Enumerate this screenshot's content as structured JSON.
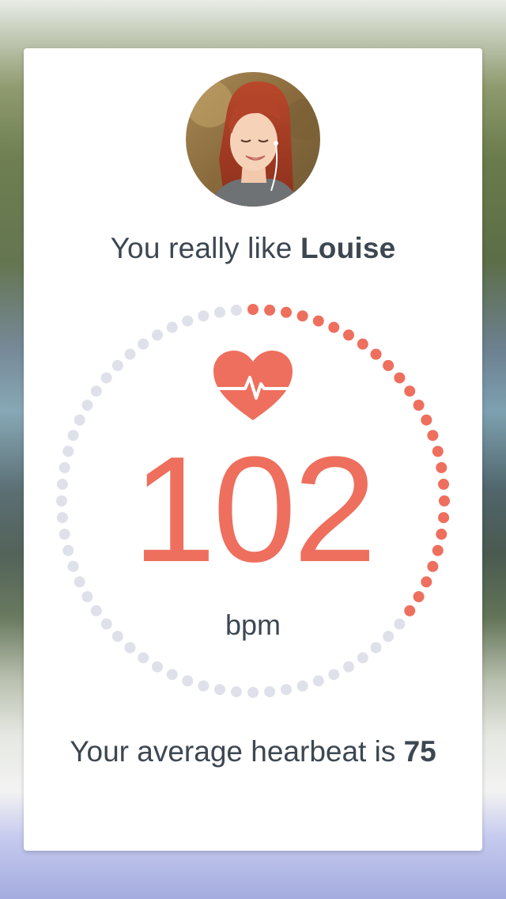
{
  "match": {
    "prefix": "You really like ",
    "name": "Louise"
  },
  "heartbeat": {
    "value": "102",
    "unit": "bpm",
    "progress_fraction": 0.36,
    "icon": "heart-pulse-icon"
  },
  "average": {
    "prefix": "Your average hearbeat is ",
    "value": "75"
  },
  "colors": {
    "accent": "#ee6f5d",
    "ring_inactive": "#dfe1ea",
    "text": "#3d4751"
  }
}
